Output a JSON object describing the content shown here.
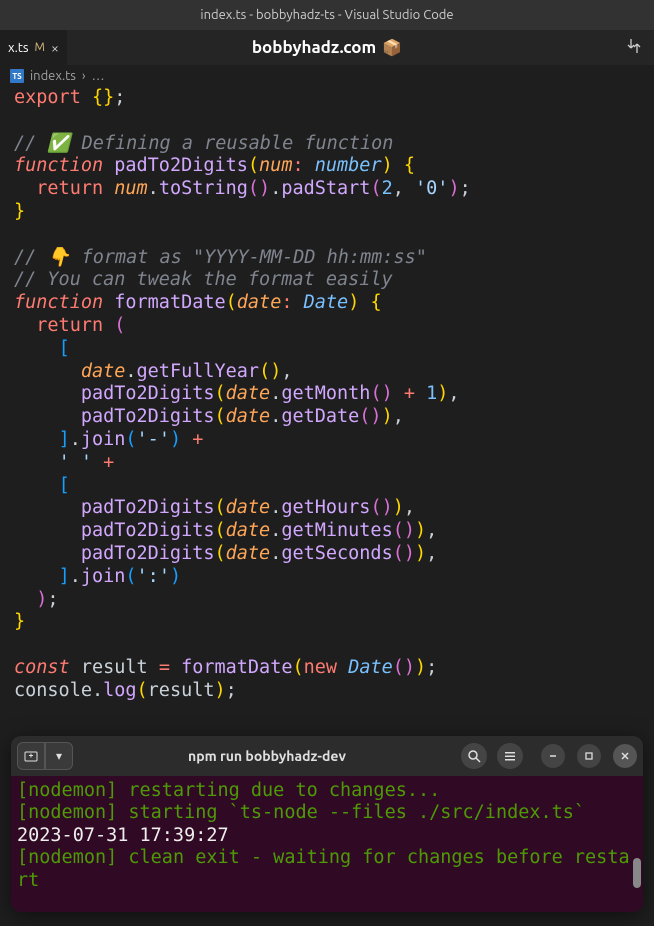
{
  "window_title": "index.ts - bobbyhadz-ts - Visual Studio Code",
  "tab": {
    "name": "x.ts",
    "modified_marker": "M",
    "close": "×"
  },
  "banner": "bobbyhadz.com",
  "banner_icon": "📦",
  "breadcrumb": {
    "file": "index.ts",
    "sep": "›",
    "rest": "…"
  },
  "code": {
    "l1": {
      "export": "export",
      "braces": "{}",
      "semi": ";"
    },
    "l3": {
      "comment": "// ✅ Defining a reusable function"
    },
    "l4": {
      "function": "function",
      "name": "padTo2Digits",
      "lp": "(",
      "param": "num",
      "colon": ":",
      "type": "number",
      "rp": ")",
      "ob": "{"
    },
    "l5": {
      "ret": "return",
      "id": "num",
      "dot1": ".",
      "m1": "toString",
      "p1": "()",
      "dot2": ".",
      "m2": "padStart",
      "lp": "(",
      "n": "2",
      "c": ",",
      "s": "'0'",
      "rp": ")",
      "semi": ";"
    },
    "l6": {
      "cb": "}"
    },
    "l8": {
      "comment": "// 👇 format as \"YYYY-MM-DD hh:mm:ss\""
    },
    "l9": {
      "comment": "// You can tweak the format easily"
    },
    "l10": {
      "function": "function",
      "name": "formatDate",
      "lp": "(",
      "param": "date",
      "colon": ":",
      "type": "Date",
      "rp": ")",
      "ob": "{"
    },
    "l11": {
      "ret": "return",
      "lp": "("
    },
    "l12": {
      "lb": "["
    },
    "l13": {
      "id": "date",
      "dot": ".",
      "m": "getFullYear",
      "p": "()",
      "c": ","
    },
    "l14": {
      "fn": "padTo2Digits",
      "lp": "(",
      "id": "date",
      "dot": ".",
      "m": "getMonth",
      "p": "()",
      "op": "+",
      "n": "1",
      "rp": ")",
      "c": ","
    },
    "l15": {
      "fn": "padTo2Digits",
      "lp": "(",
      "id": "date",
      "dot": ".",
      "m": "getDate",
      "p": "()",
      "rp": ")",
      "c": ","
    },
    "l16": {
      "rb": "]",
      "dot": ".",
      "m": "join",
      "lp": "(",
      "s": "'-'",
      "rp": ")",
      "op": "+"
    },
    "l17": {
      "s": "' '",
      "op": "+"
    },
    "l18": {
      "lb": "["
    },
    "l19": {
      "fn": "padTo2Digits",
      "lp": "(",
      "id": "date",
      "dot": ".",
      "m": "getHours",
      "p": "()",
      "rp": ")",
      "c": ","
    },
    "l20": {
      "fn": "padTo2Digits",
      "lp": "(",
      "id": "date",
      "dot": ".",
      "m": "getMinutes",
      "p": "()",
      "rp": ")",
      "c": ","
    },
    "l21": {
      "fn": "padTo2Digits",
      "lp": "(",
      "id": "date",
      "dot": ".",
      "m": "getSeconds",
      "p": "()",
      "rp": ")",
      "c": ","
    },
    "l22": {
      "rb": "]",
      "dot": ".",
      "m": "join",
      "lp": "(",
      "s": "':'",
      "rp": ")"
    },
    "l23": {
      "rp": ")",
      "semi": ";"
    },
    "l24": {
      "cb": "}"
    },
    "l26": {
      "const": "const",
      "id": "result",
      "eq": "=",
      "fn": "formatDate",
      "lp": "(",
      "new": "new",
      "type": "Date",
      "p": "()",
      "rp": ")",
      "semi": ";"
    },
    "l27": {
      "id1": "console",
      "dot": ".",
      "m": "log",
      "lp": "(",
      "id2": "result",
      "rp": ")",
      "semi": ";"
    }
  },
  "terminal": {
    "title": "npm run bobbyhadz-dev",
    "lines": {
      "l1a": "[nodemon] ",
      "l1b": "restarting due to changes...",
      "l2a": "[nodemon] ",
      "l2b": "starting `ts-node --files ./src/index.ts`",
      "l3": "2023-07-31 17:39:27",
      "l4a": "[nodemon] ",
      "l4b": "clean exit - waiting for changes before restart"
    }
  }
}
